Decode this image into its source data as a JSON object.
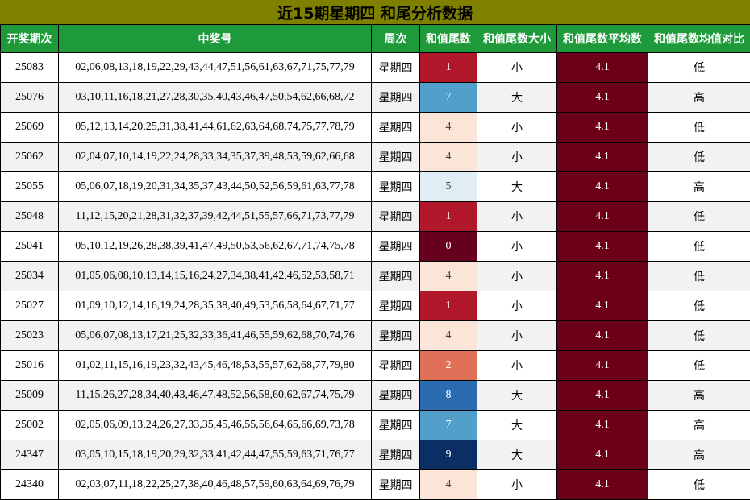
{
  "title": "近15期星期四 和尾分析数据",
  "headers": [
    "开奖期次",
    "中奖号",
    "周次",
    "和值尾数",
    "和值尾数大小",
    "和值尾数平均数",
    "和值尾数均值对比"
  ],
  "rows": [
    {
      "period": "25083",
      "numbers": "02,06,08,13,18,19,22,29,43,44,47,51,56,61,63,67,71,75,77,79",
      "week": "星期四",
      "tail": "1",
      "tail_color": "#b2182b",
      "tail_light": true,
      "size": "小",
      "avg": "4.1",
      "compare": "低"
    },
    {
      "period": "25076",
      "numbers": "03,10,11,16,18,21,27,28,30,35,40,43,46,47,50,54,62,66,68,72",
      "week": "星期四",
      "tail": "7",
      "tail_color": "#539fcb",
      "tail_light": true,
      "size": "大",
      "avg": "4.1",
      "compare": "高"
    },
    {
      "period": "25069",
      "numbers": "05,12,13,14,20,25,31,38,41,44,61,62,63,64,68,74,75,77,78,79",
      "week": "星期四",
      "tail": "4",
      "tail_color": "#fbe5d8",
      "tail_light": false,
      "size": "小",
      "avg": "4.1",
      "compare": "低"
    },
    {
      "period": "25062",
      "numbers": "02,04,07,10,14,19,22,24,28,33,34,35,37,39,48,53,59,62,66,68",
      "week": "星期四",
      "tail": "4",
      "tail_color": "#fbe5d8",
      "tail_light": false,
      "size": "小",
      "avg": "4.1",
      "compare": "低"
    },
    {
      "period": "25055",
      "numbers": "05,06,07,18,19,20,31,34,35,37,43,44,50,52,56,59,61,63,77,78",
      "week": "星期四",
      "tail": "5",
      "tail_color": "#e1edf4",
      "tail_light": false,
      "size": "大",
      "avg": "4.1",
      "compare": "高"
    },
    {
      "period": "25048",
      "numbers": "11,12,15,20,21,28,31,32,37,39,42,44,51,55,57,66,71,73,77,79",
      "week": "星期四",
      "tail": "1",
      "tail_color": "#b2182b",
      "tail_light": true,
      "size": "小",
      "avg": "4.1",
      "compare": "低"
    },
    {
      "period": "25041",
      "numbers": "05,10,12,19,26,28,38,39,41,47,49,50,53,56,62,67,71,74,75,78",
      "week": "星期四",
      "tail": "0",
      "tail_color": "#67001f",
      "tail_light": true,
      "size": "小",
      "avg": "4.1",
      "compare": "低"
    },
    {
      "period": "25034",
      "numbers": "01,05,06,08,10,13,14,15,16,24,27,34,38,41,42,46,52,53,58,71",
      "week": "星期四",
      "tail": "4",
      "tail_color": "#fbe5d8",
      "tail_light": false,
      "size": "小",
      "avg": "4.1",
      "compare": "低"
    },
    {
      "period": "25027",
      "numbers": "01,09,10,12,14,16,19,24,28,35,38,40,49,53,56,58,64,67,71,77",
      "week": "星期四",
      "tail": "1",
      "tail_color": "#b2182b",
      "tail_light": true,
      "size": "小",
      "avg": "4.1",
      "compare": "低"
    },
    {
      "period": "25023",
      "numbers": "05,06,07,08,13,17,21,25,32,33,36,41,46,55,59,62,68,70,74,76",
      "week": "星期四",
      "tail": "4",
      "tail_color": "#fbe5d8",
      "tail_light": false,
      "size": "小",
      "avg": "4.1",
      "compare": "低"
    },
    {
      "period": "25016",
      "numbers": "01,02,11,15,16,19,23,32,43,45,46,48,53,55,57,62,68,77,79,80",
      "week": "星期四",
      "tail": "2",
      "tail_color": "#e07058",
      "tail_light": true,
      "size": "小",
      "avg": "4.1",
      "compare": "低"
    },
    {
      "period": "25009",
      "numbers": "11,15,26,27,28,34,40,43,46,47,48,52,56,58,60,62,67,74,75,79",
      "week": "星期四",
      "tail": "8",
      "tail_color": "#2b6cb0",
      "tail_light": true,
      "size": "大",
      "avg": "4.1",
      "compare": "高"
    },
    {
      "period": "25002",
      "numbers": "02,05,06,09,13,24,26,27,33,35,45,46,55,56,64,65,66,69,73,78",
      "week": "星期四",
      "tail": "7",
      "tail_color": "#539fcb",
      "tail_light": true,
      "size": "大",
      "avg": "4.1",
      "compare": "高"
    },
    {
      "period": "24347",
      "numbers": "03,05,10,15,18,19,20,29,32,33,41,42,44,47,55,59,63,71,76,77",
      "week": "星期四",
      "tail": "9",
      "tail_color": "#0b2f64",
      "tail_light": true,
      "size": "大",
      "avg": "4.1",
      "compare": "高"
    },
    {
      "period": "24340",
      "numbers": "02,03,07,11,18,22,25,27,38,40,46,48,57,59,60,63,64,69,76,79",
      "week": "星期四",
      "tail": "4",
      "tail_color": "#fbe5d8",
      "tail_light": false,
      "size": "小",
      "avg": "4.1",
      "compare": "低"
    }
  ]
}
